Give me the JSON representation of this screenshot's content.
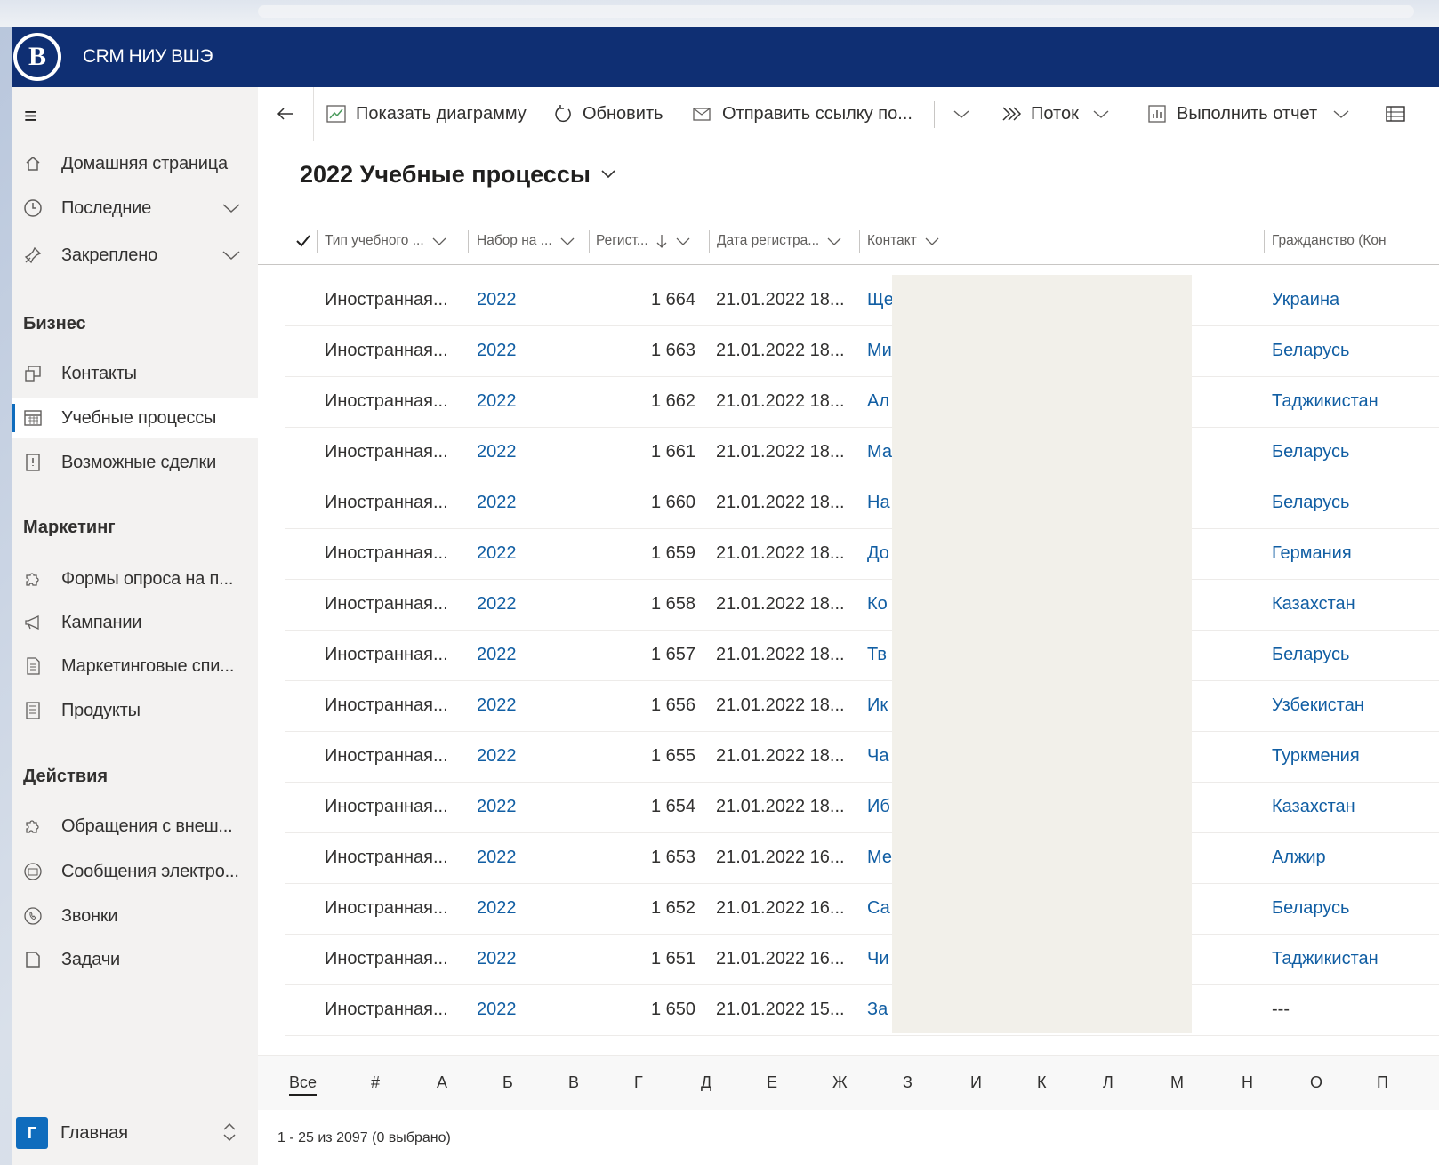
{
  "app": {
    "title": "CRM НИУ ВШЭ",
    "logo_letter": "В"
  },
  "sidebar": {
    "home": "Домашняя страница",
    "recent": "Последние",
    "pinned": "Закреплено",
    "groups": [
      {
        "title": "Бизнес",
        "items": [
          "Контакты",
          "Учебные процессы",
          "Возможные сделки"
        ]
      },
      {
        "title": "Маркетинг",
        "items": [
          "Формы опроса на п...",
          "Кампании",
          "Маркетинговые спи...",
          "Продукты"
        ]
      },
      {
        "title": "Действия",
        "items": [
          "Обращения с внеш...",
          "Сообщения электро...",
          "Звонки",
          "Задачи"
        ]
      }
    ],
    "active_item": "Учебные процессы",
    "area": {
      "badge": "Г",
      "label": "Главная"
    }
  },
  "commandbar": {
    "show_chart": "Показать диаграмму",
    "refresh": "Обновить",
    "send_link": "Отправить ссылку по...",
    "flow": "Поток",
    "run_report": "Выполнить отчет"
  },
  "view": {
    "title": "2022 Учебные процессы"
  },
  "grid": {
    "headers": {
      "type": "Тип учебного ...",
      "intake": "Набор на ...",
      "reg": "Регист...",
      "date": "Дата регистра...",
      "contact": "Контакт",
      "citizenship": "Гражданство (Кон"
    },
    "rows": [
      {
        "type": "Иностранная...",
        "intake": "2022",
        "num": "1 664",
        "date": "21.01.2022 18...",
        "contact": "Ще",
        "citizenship": "Украина"
      },
      {
        "type": "Иностранная...",
        "intake": "2022",
        "num": "1 663",
        "date": "21.01.2022 18...",
        "contact": "Ми",
        "citizenship": "Беларусь"
      },
      {
        "type": "Иностранная...",
        "intake": "2022",
        "num": "1 662",
        "date": "21.01.2022 18...",
        "contact": "Ал",
        "citizenship": "Таджикистан"
      },
      {
        "type": "Иностранная...",
        "intake": "2022",
        "num": "1 661",
        "date": "21.01.2022 18...",
        "contact": "Ма",
        "citizenship": "Беларусь"
      },
      {
        "type": "Иностранная...",
        "intake": "2022",
        "num": "1 660",
        "date": "21.01.2022 18...",
        "contact": "На",
        "citizenship": "Беларусь"
      },
      {
        "type": "Иностранная...",
        "intake": "2022",
        "num": "1 659",
        "date": "21.01.2022 18...",
        "contact": "До",
        "citizenship": "Германия"
      },
      {
        "type": "Иностранная...",
        "intake": "2022",
        "num": "1 658",
        "date": "21.01.2022 18...",
        "contact": "Ко",
        "citizenship": "Казахстан"
      },
      {
        "type": "Иностранная...",
        "intake": "2022",
        "num": "1 657",
        "date": "21.01.2022 18...",
        "contact": "Тв",
        "citizenship": "Беларусь"
      },
      {
        "type": "Иностранная...",
        "intake": "2022",
        "num": "1 656",
        "date": "21.01.2022 18...",
        "contact": "Ик",
        "citizenship": "Узбекистан"
      },
      {
        "type": "Иностранная...",
        "intake": "2022",
        "num": "1 655",
        "date": "21.01.2022 18...",
        "contact": "Ча",
        "citizenship": "Туркмения"
      },
      {
        "type": "Иностранная...",
        "intake": "2022",
        "num": "1 654",
        "date": "21.01.2022 18...",
        "contact": "Иб",
        "citizenship": "Казахстан"
      },
      {
        "type": "Иностранная...",
        "intake": "2022",
        "num": "1 653",
        "date": "21.01.2022 16...",
        "contact": "Ме",
        "citizenship": "Алжир"
      },
      {
        "type": "Иностранная...",
        "intake": "2022",
        "num": "1 652",
        "date": "21.01.2022 16...",
        "contact": "Са",
        "citizenship": "Беларусь"
      },
      {
        "type": "Иностранная...",
        "intake": "2022",
        "num": "1 651",
        "date": "21.01.2022 16...",
        "contact": "Чи",
        "citizenship": "Таджикистан"
      },
      {
        "type": "Иностранная...",
        "intake": "2022",
        "num": "1 650",
        "date": "21.01.2022 15...",
        "contact": "За",
        "citizenship": "---"
      }
    ]
  },
  "alphabet": [
    "Все",
    "#",
    "А",
    "Б",
    "В",
    "Г",
    "Д",
    "Е",
    "Ж",
    "З",
    "И",
    "К",
    "Л",
    "М",
    "Н",
    "О",
    "П"
  ],
  "footer": {
    "status": "1 - 25 из 2097 (0 выбрано)"
  }
}
